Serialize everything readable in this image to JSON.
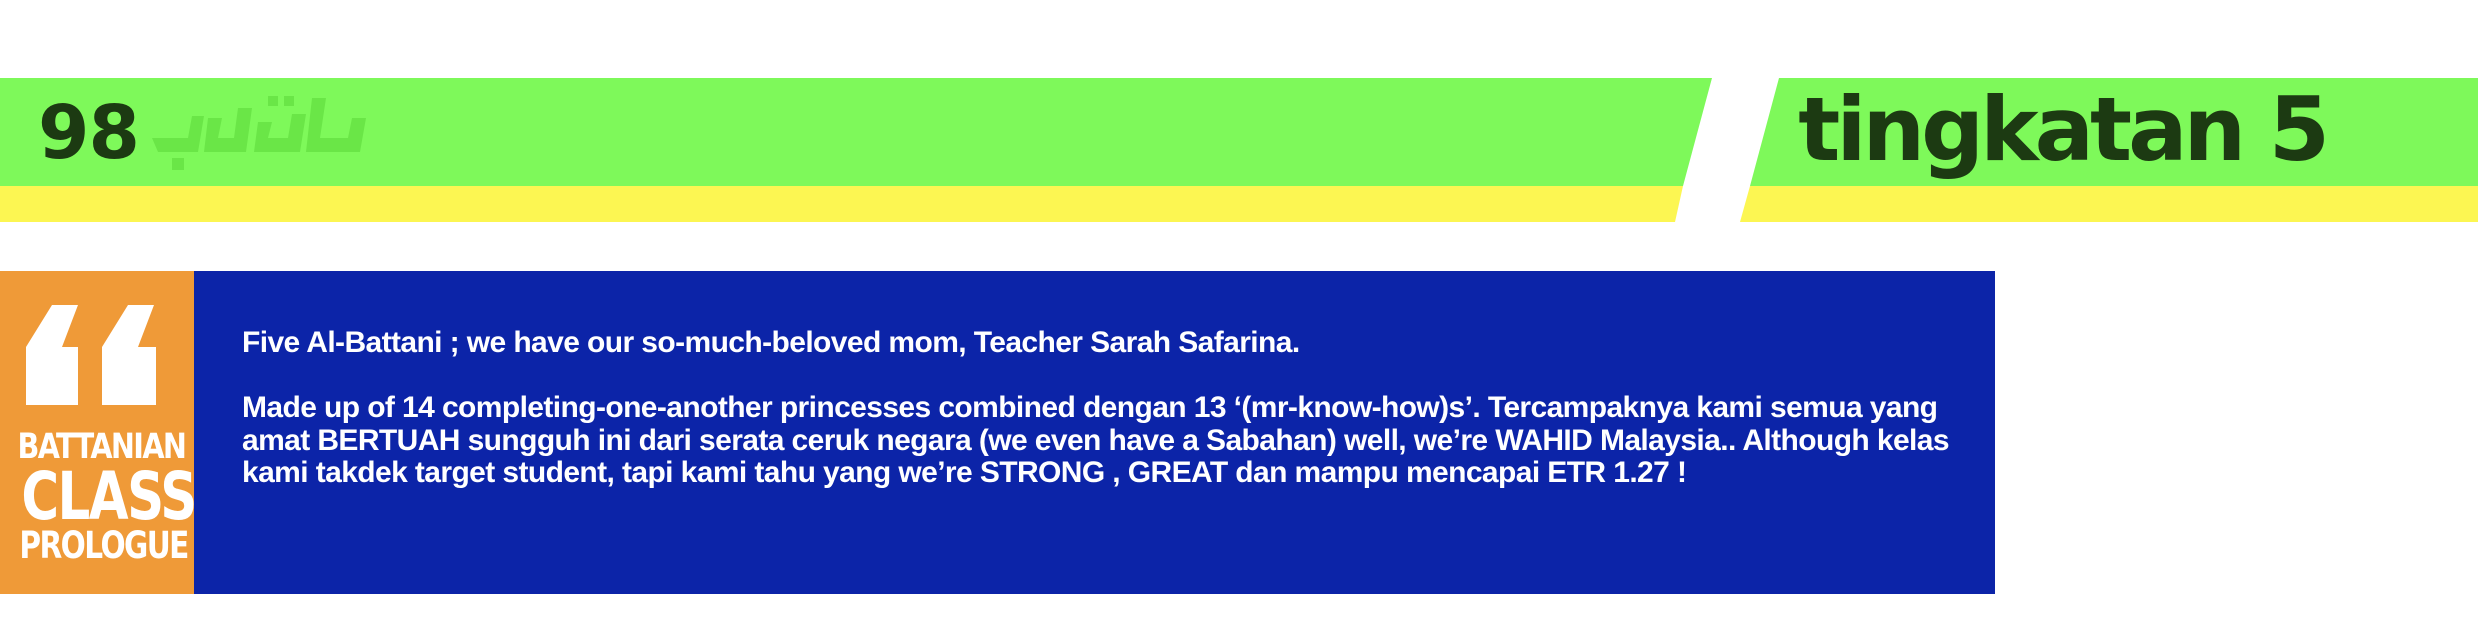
{
  "header": {
    "page_number": "98",
    "form_title": "tingkatan 5",
    "colors": {
      "green": "#7ef95a",
      "yellow": "#fcf652",
      "title_text": "#1c3a12"
    }
  },
  "prologue_card": {
    "side_label": {
      "line1": "BATTANIAN",
      "line2": "CLASS",
      "line3": "PROLOGUE"
    },
    "quote_icon": "open-quote-icon",
    "paragraphs": [
      "Five Al-Battani ; we have our so-much-beloved mom, Teacher Sarah Safarina.",
      "Made up of 14 completing-one-another princesses combined dengan 13 ‘(mr-know-how)s’. Tercampaknya kami semua yang amat BERTUAH sungguh ini dari serata ceruk negara (we even have a Sabahan) well, we’re WAHID Malaysia.. Although kelas kami takdek target student, tapi kami tahu yang we’re STRONG , GREAT dan mampu mencapai ETR 1.27 !"
    ],
    "colors": {
      "card_background": "#0c24a8",
      "side_background": "#ef9a38",
      "text": "#ffffff"
    }
  }
}
